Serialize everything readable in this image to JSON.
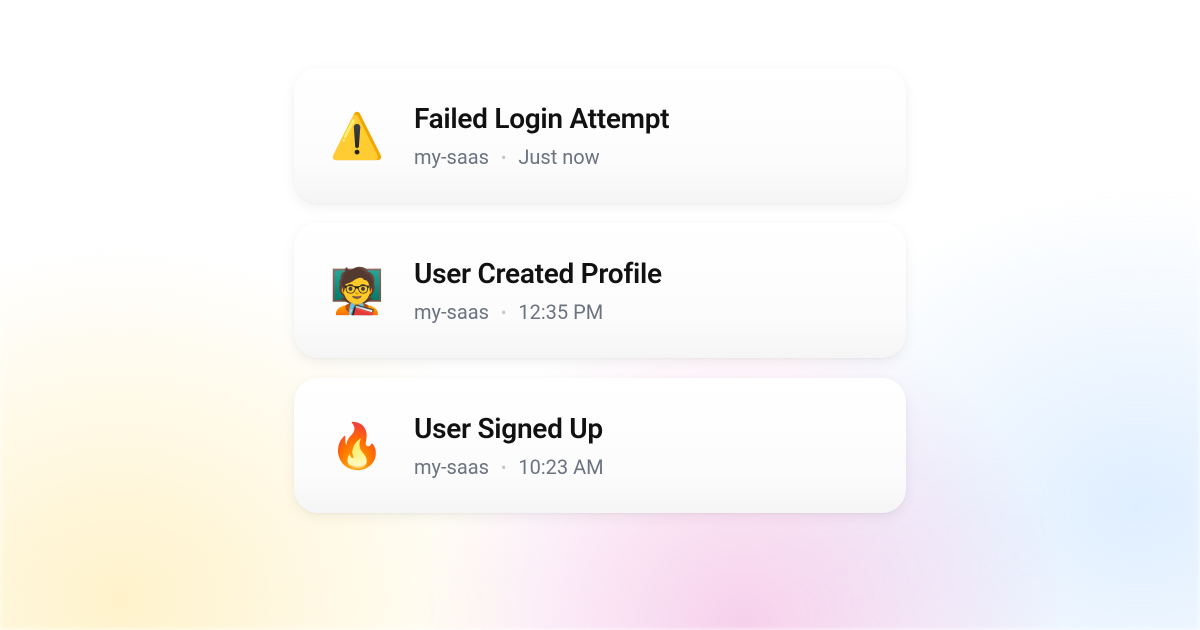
{
  "events": [
    {
      "icon": "⚠️",
      "icon_name": "warning-icon",
      "title": "Failed Login Attempt",
      "source": "my-saas",
      "time": "Just now"
    },
    {
      "icon": "🧑‍🏫",
      "icon_name": "teacher-icon",
      "title": "User Created Profile",
      "source": "my-saas",
      "time": "12:35 PM"
    },
    {
      "icon": "🔥",
      "icon_name": "fire-icon",
      "title": "User Signed Up",
      "source": "my-saas",
      "time": "10:23 AM"
    }
  ]
}
